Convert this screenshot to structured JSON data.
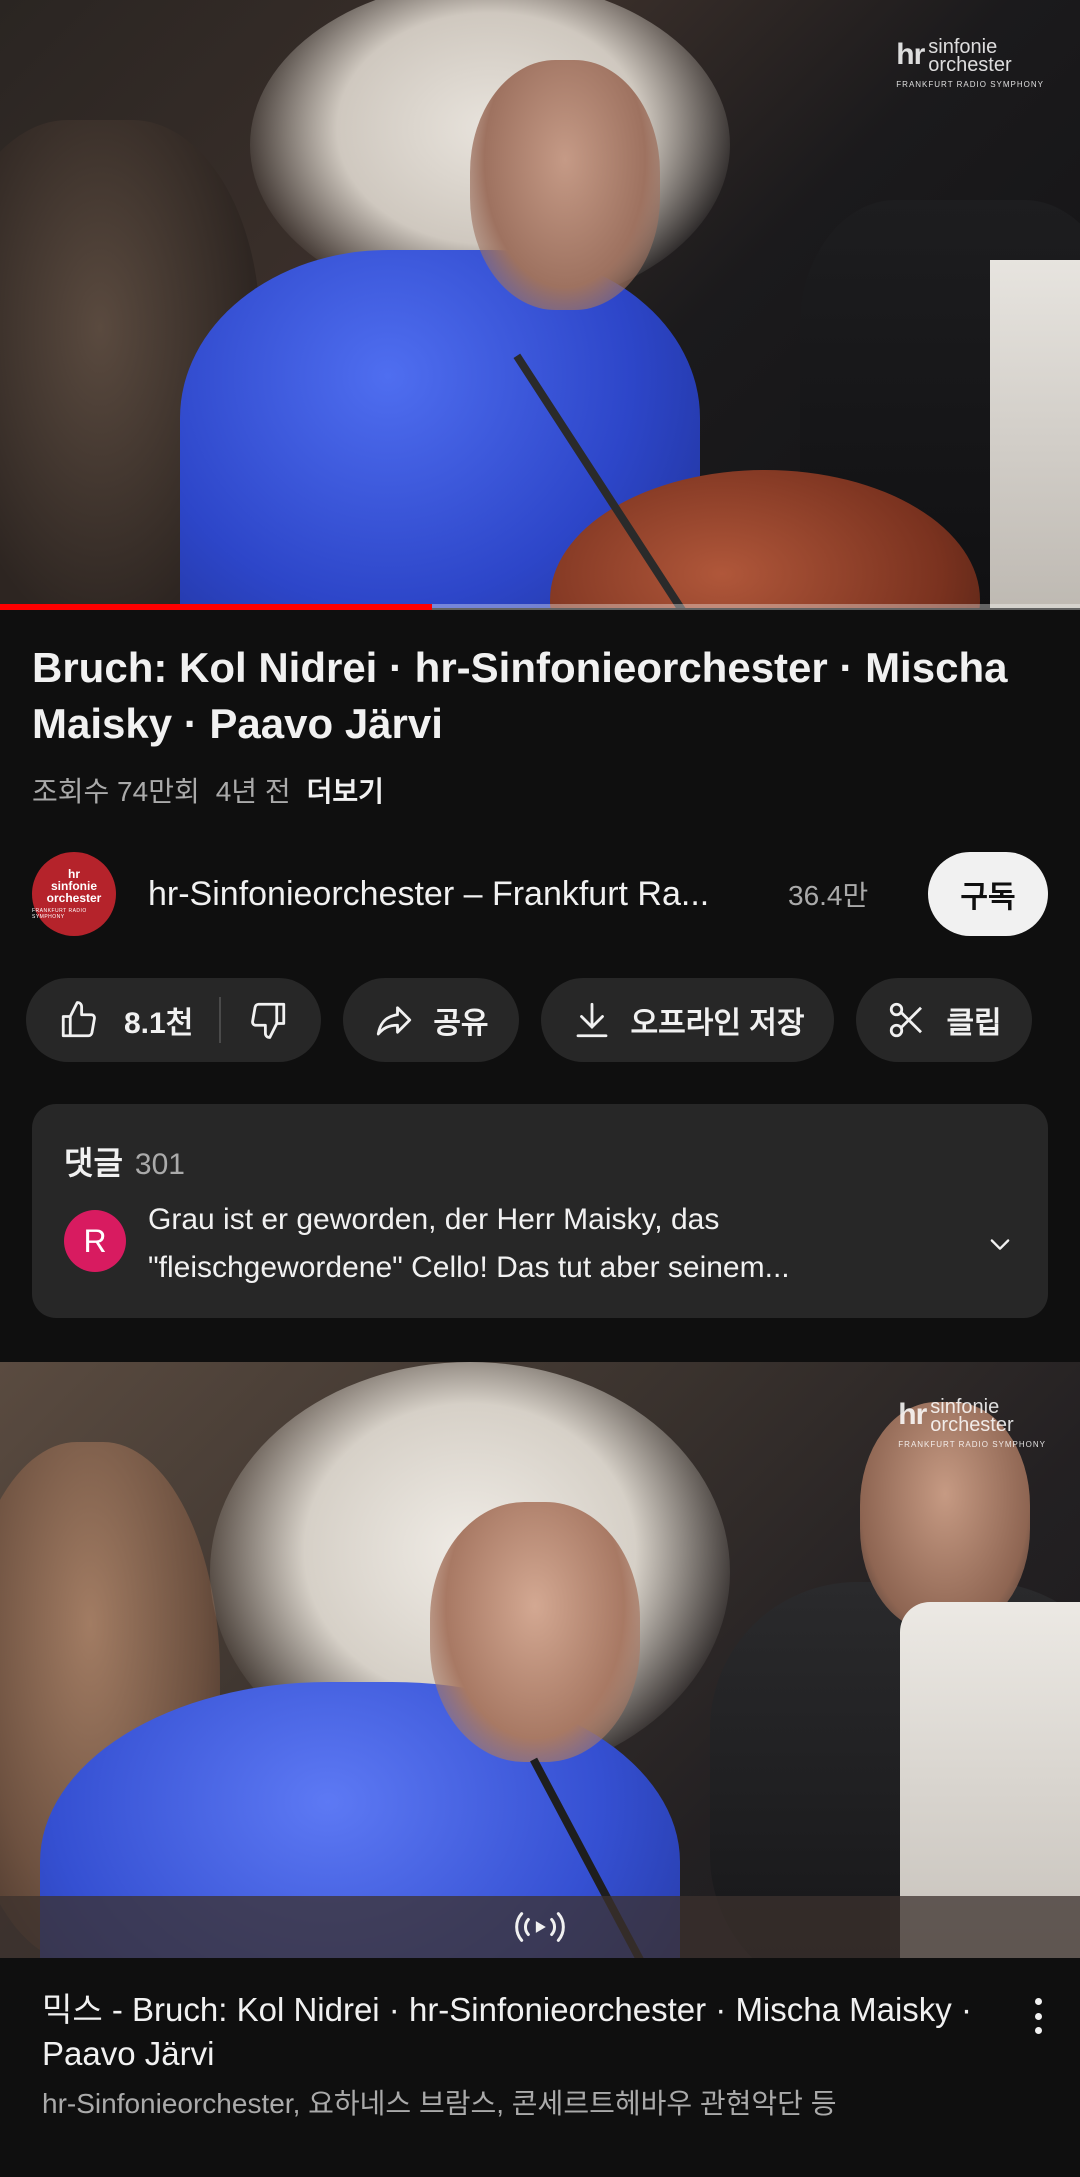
{
  "player": {
    "progress_fraction": 0.4,
    "logo": {
      "mark": "hr",
      "line1": "sinfonie",
      "line2": "orchester",
      "sub": "FRANKFURT RADIO SYMPHONY"
    }
  },
  "video": {
    "title": "Bruch: Kol Nidrei · hr-Sinfonieorchester · Mischa Maisky · Paavo Järvi",
    "views": "조회수 74만회",
    "age": "4년 전",
    "more_label": "더보기"
  },
  "channel": {
    "avatar_text": "hr sinfonie orchester",
    "avatar_sub": "FRANKFURT RADIO SYMPHONY",
    "name": "hr-Sinfonieorchester – Frankfurt Ra...",
    "subscribers": "36.4만",
    "subscribe_label": "구독"
  },
  "actions": {
    "likes": "8.1천",
    "share_label": "공유",
    "offline_label": "오프라인 저장",
    "clip_label": "클립"
  },
  "comments": {
    "header": "댓글",
    "count": "301",
    "avatar_letter": "R",
    "top_comment": "Grau ist er geworden, der Herr Maisky, das \"fleischgewordene\" Cello! Das tut aber seinem..."
  },
  "next_video": {
    "title": "믹스 - Bruch: Kol Nidrei · hr-Sinfonieorchester · Mischa Maisky · Paavo Järvi",
    "subtitle": "hr-Sinfonieorchester, 요하네스 브람스, 콘세르트헤바우 관현악단 등",
    "logo": {
      "mark": "hr",
      "line1": "sinfonie",
      "line2": "orchester",
      "sub": "FRANKFURT RADIO SYMPHONY"
    }
  },
  "colors": {
    "accent": "#ff0000",
    "background": "#0f0f0f",
    "chip": "#272727",
    "comment_avatar": "#d81b60"
  },
  "icons": [
    "thumbs-up-icon",
    "thumbs-down-icon",
    "share-icon",
    "download-icon",
    "scissors-icon",
    "chevron-down-icon",
    "live-broadcast-icon",
    "more-vert-icon"
  ]
}
